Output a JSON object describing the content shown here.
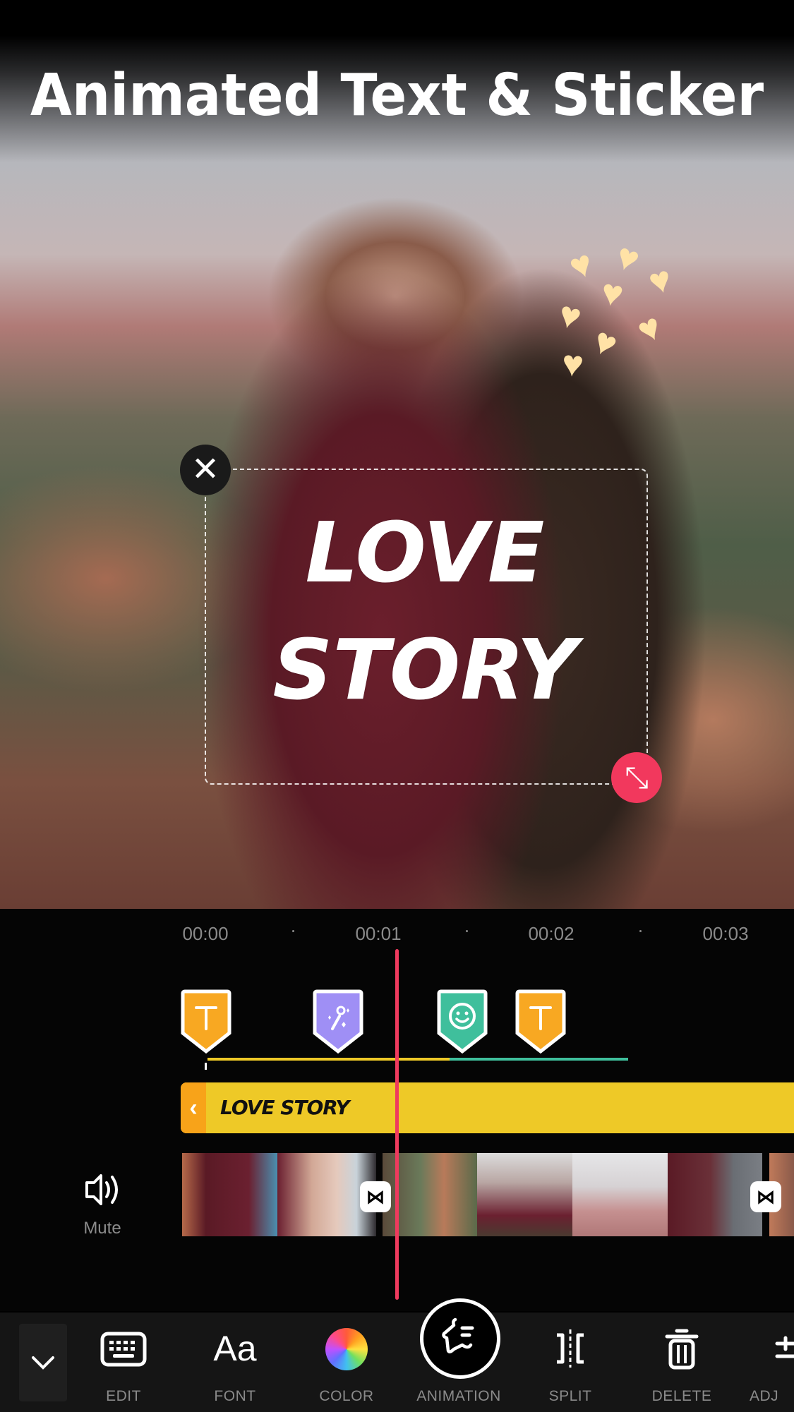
{
  "promo": {
    "title": "Animated Text & Sticker"
  },
  "canvas": {
    "overlay_text_line1": "LOVE",
    "overlay_text_line2": "STORY",
    "close_glyph": "✕",
    "resize_glyph": "⤡",
    "sticker": {
      "name": "hearts",
      "glyph": "♥",
      "color": "#ffe2a6"
    }
  },
  "timeline": {
    "ruler": [
      "00:00",
      "00:01",
      "00:02",
      "00:03"
    ],
    "markers": [
      {
        "type": "text",
        "icon": "text-t-icon",
        "color": "#f8a822"
      },
      {
        "type": "effect",
        "icon": "magic-wand-icon",
        "color": "#9f8ff5"
      },
      {
        "type": "sticker",
        "icon": "smiley-icon",
        "color": "#3fbf9c"
      },
      {
        "type": "text",
        "icon": "text-t-icon",
        "color": "#f8a822"
      }
    ],
    "keyline_colors": {
      "text": "#eec927",
      "sticker": "#3fbf9c"
    },
    "text_track": {
      "label": "LOVE STORY",
      "handle_glyph": "‹",
      "color": "#eec927",
      "handle_color": "#f8a319"
    },
    "audio": {
      "label": "Mute"
    },
    "transition_glyph": "⋈",
    "playhead_color": "#ef3a5e"
  },
  "toolbar": {
    "collapse_glyph": "⌄",
    "tools": [
      {
        "id": "edit",
        "label": "EDIT",
        "icon": "keyboard-icon"
      },
      {
        "id": "font",
        "label": "FONT",
        "icon": "font-aa-icon",
        "glyph": "Aa"
      },
      {
        "id": "color",
        "label": "COLOR",
        "icon": "color-wheel-icon"
      },
      {
        "id": "animation",
        "label": "ANIMATION",
        "icon": "animation-star-icon",
        "active": true
      },
      {
        "id": "split",
        "label": "SPLIT",
        "icon": "split-icon"
      },
      {
        "id": "delete",
        "label": "DELETE",
        "icon": "trash-icon"
      },
      {
        "id": "adjust",
        "label": "ADJ",
        "icon": "adjust-icon"
      }
    ]
  }
}
